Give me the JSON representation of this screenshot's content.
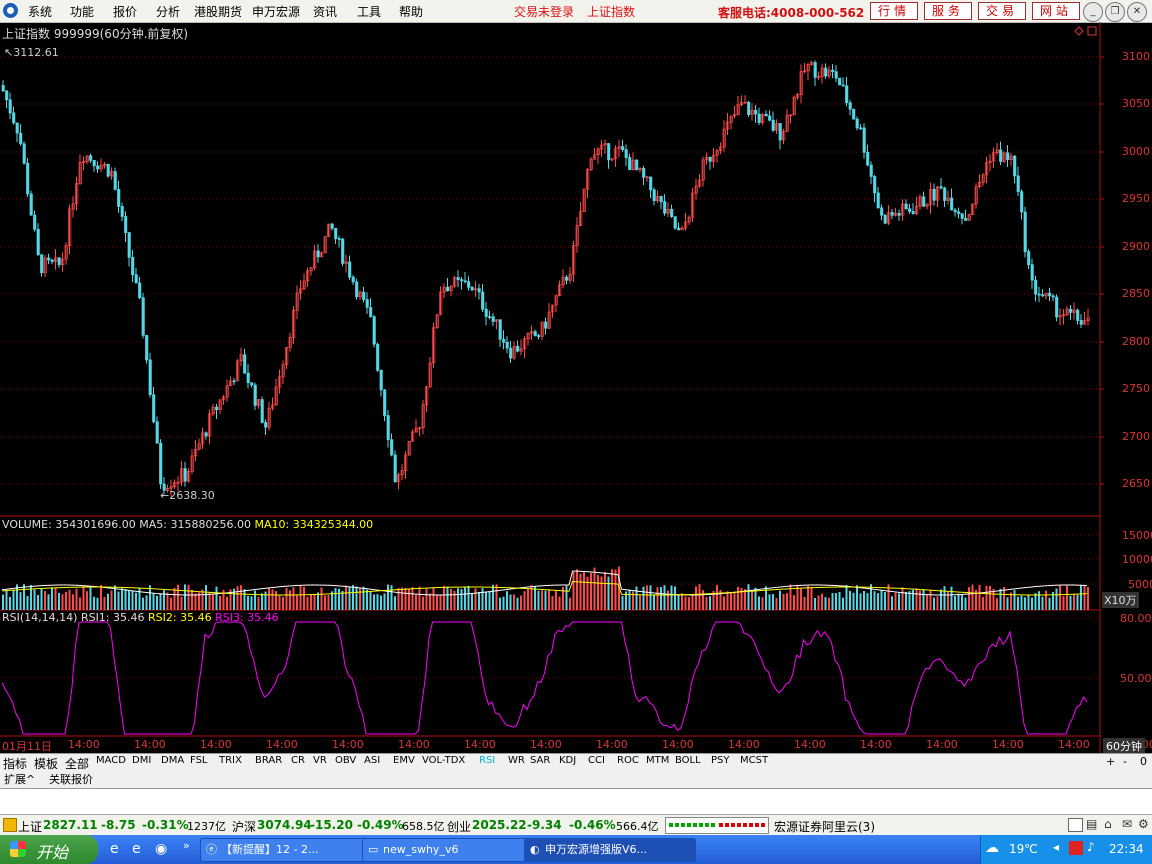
{
  "menu": {
    "items": [
      "系统",
      "功能",
      "报价",
      "分析",
      "港股期货",
      "申万宏源",
      "资讯",
      "工具",
      "帮助"
    ],
    "trade_status": "交易未登录",
    "index_link": "上证指数",
    "hotline": "客服电话:4008-000-562",
    "buttons": [
      "行情",
      "服务",
      "交易",
      "网站"
    ]
  },
  "chart": {
    "title": "上证指数 999999(60分钟.前复权)",
    "high_mark": "3112.61",
    "low_mark": "2638.30",
    "y_labels": [
      "3100",
      "3050",
      "3000",
      "2950",
      "2900",
      "2850",
      "2800",
      "2750",
      "2700",
      "2650"
    ],
    "colors": {
      "up": "#ff4a4a",
      "down": "#54d8e6",
      "ma5": "#ffffff",
      "ma10": "#ffff00",
      "rsi": "#ff00ff",
      "grid": "#8b0000"
    }
  },
  "volume": {
    "label": "VOLUME:",
    "value": "354301696.00",
    "ma5_label": "MA5:",
    "ma5": "315880256.00",
    "ma10_label": "MA10:",
    "ma10": "334325344.00",
    "y_labels": [
      "15000",
      "10000",
      "5000"
    ],
    "unit": "X10万"
  },
  "rsi": {
    "label": "RSI(14,14,14)",
    "rsi1_label": "RSI1:",
    "rsi1": "35.46",
    "rsi2_label": "RSI2:",
    "rsi2": "35.46",
    "rsi3_label": "RSI3:",
    "rsi3": "35.46",
    "y_labels": [
      "80.00",
      "50.00"
    ]
  },
  "time_axis": {
    "labels": [
      "01月11日",
      "14:00",
      "14:00",
      "14:00",
      "14:00",
      "14:00",
      "14:00",
      "14:00",
      "14:00",
      "14:00",
      "14:00",
      "14:00",
      "14:00",
      "14:00",
      "14:00",
      "14:00",
      "14:00",
      "14:00"
    ],
    "period": "60分钟"
  },
  "tabs": [
    "指标",
    "模板",
    "全部",
    "MACD",
    "DMI",
    "DMA",
    "FSL",
    "TRIX",
    "BRAR",
    "CR",
    "VR",
    "OBV",
    "ASI",
    "EMV",
    "VOL-TDX",
    "RSI",
    "WR",
    "SAR",
    "KDJ",
    "CCI",
    "ROC",
    "MTM",
    "BOLL",
    "PSY",
    "MCST"
  ],
  "tab_controls": [
    "+",
    "-",
    "0"
  ],
  "extensions": [
    "扩展^",
    "关联报价"
  ],
  "status": {
    "sh_name": "上证",
    "sh_value": "2827.11",
    "sh_change": "-8.75",
    "sh_pct": "-0.31%",
    "sh_amount": "1237亿",
    "hs_name": "沪深",
    "hs_value": "3074.94",
    "hs_change": "-15.20",
    "hs_pct": "-0.49%",
    "hs_amount": "658.5亿",
    "cy_name": "创业",
    "cy_value": "2025.22",
    "cy_change": "-9.34",
    "cy_pct": "-0.46%",
    "cy_amount": "566.4亿",
    "broker": "宏源证券阿里云(3)"
  },
  "taskbar": {
    "start": "开始",
    "items": [
      "【新提醒】12 - 2...",
      "new_swhy_v6",
      "申万宏源增强版V6..."
    ],
    "weather": "19℃",
    "clock": "22:34"
  }
}
